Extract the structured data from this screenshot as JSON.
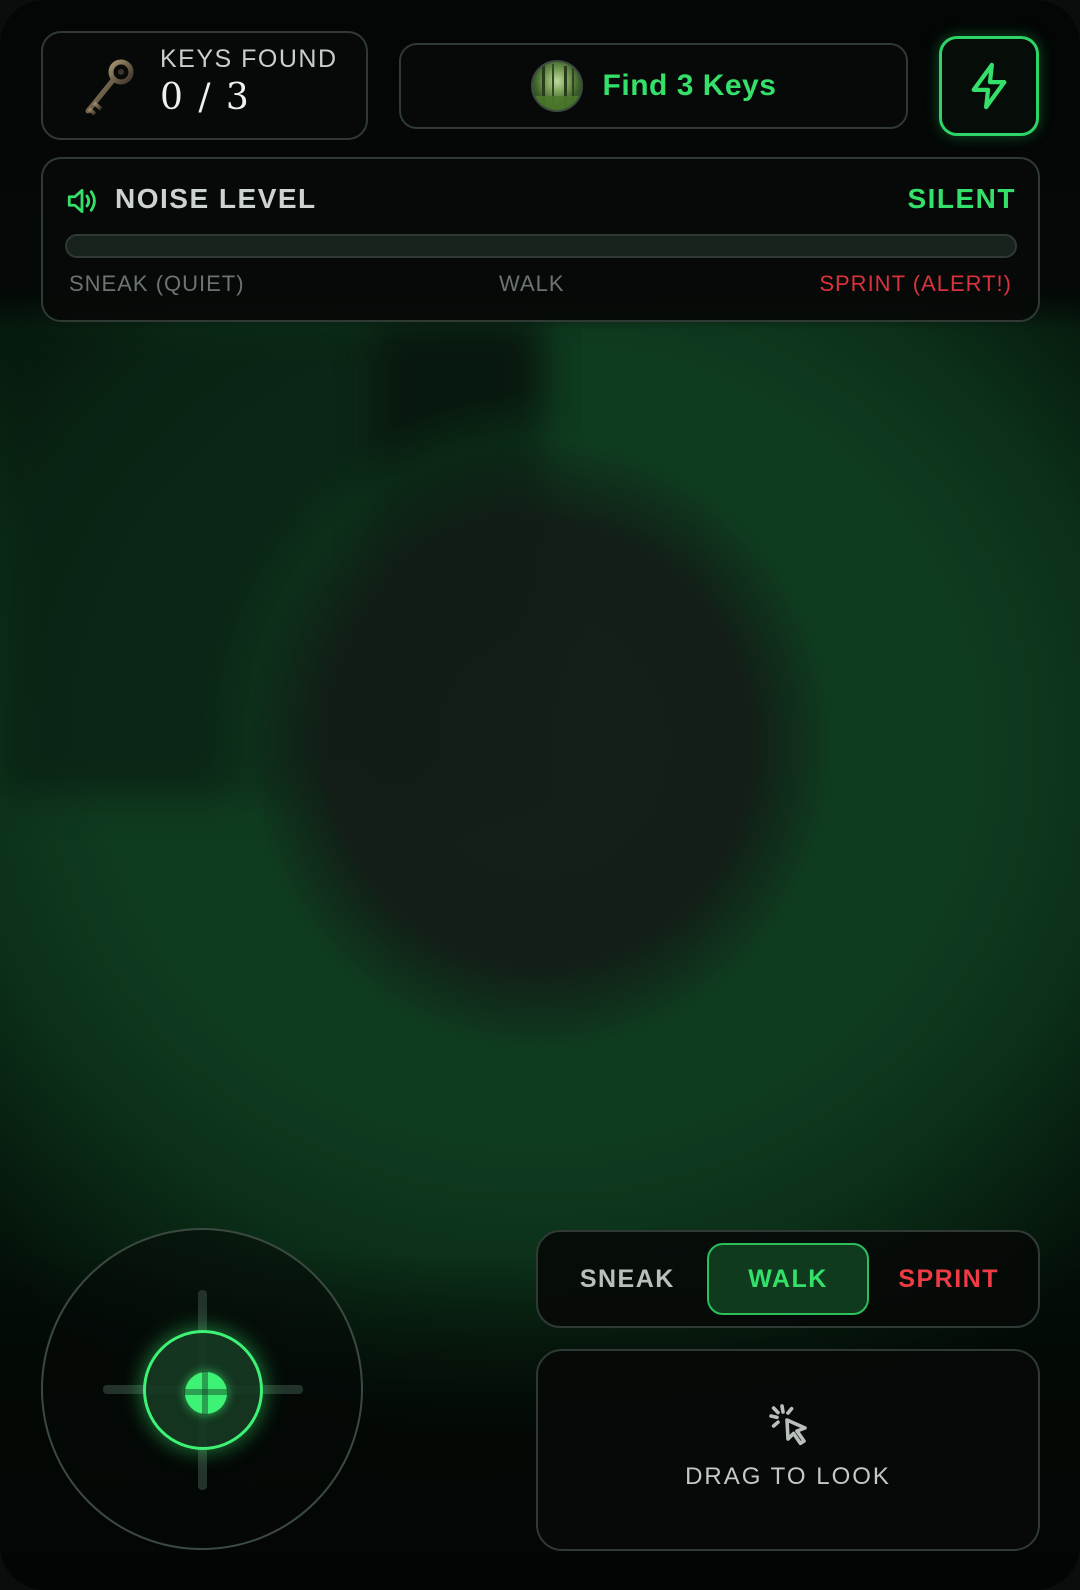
{
  "hud": {
    "keys_label": "KEYS FOUND",
    "keys_count": "0 / 3",
    "objective": "Find 3 Keys",
    "flash_icon": "lightning-bolt-icon"
  },
  "noise": {
    "title": "NOISE LEVEL",
    "status": "SILENT",
    "level": 0,
    "markers": [
      "SNEAK (QUIET)",
      "WALK",
      "SPRINT (ALERT!)"
    ],
    "icon": "speaker-icon"
  },
  "controls": {
    "speed_options": [
      "SNEAK",
      "WALK",
      "SPRINT"
    ],
    "selected_speed": "WALK",
    "look_label": "DRAG TO LOOK",
    "look_icon": "cursor-click-icon"
  },
  "colors": {
    "accent": "#35e06a",
    "alert": "#ee3b45",
    "background": "#050807"
  }
}
